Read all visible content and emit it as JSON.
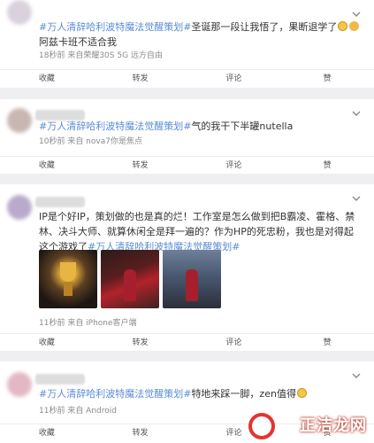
{
  "posts": [
    {
      "tag": "#万人清辞哈利波特魔法觉醒策划#",
      "text_parts": [
        "圣诞那一段让我悟了，果断退学了",
        "",
        "阿兹卡班不适合我"
      ],
      "meta": "18秒前 来自荣耀30S 5G 远方自由",
      "actions": [
        "收藏",
        "转发",
        "评论",
        "赞"
      ]
    },
    {
      "tag": "#万人清辞哈利波特魔法觉醒策划#",
      "text": "气的我干下半罐nutella",
      "meta": "10秒前 来自 nova7你是焦点",
      "actions": [
        "收藏",
        "转发",
        "评论",
        "赞"
      ]
    },
    {
      "text": "IP是个好IP，策划做的也是真的烂！工作室是怎么做到把B霸凌、霍格、禁林、决斗大师、就算休闲全是拜一遍的？作为HP的死忠粉，我也是对得起这个游戏了",
      "tag": "#万人清辞哈利波特魔法觉醒策划#",
      "meta": "11秒前 来自 iPhone客户端",
      "actions": [
        "收藏",
        "转发",
        "评论",
        "赞"
      ]
    },
    {
      "tag": "#万人清辞哈利波特魔法觉醒策划#",
      "text": "特地来踩一脚，zen值得",
      "meta": "11秒前 来自 Android",
      "actions": [
        "收藏",
        "转发",
        "评论",
        "赞"
      ]
    }
  ],
  "icons": {
    "emoji_1": "nerd-face-icon",
    "emoji_2": "crying-face-icon",
    "emoji_3": "sweat-face-icon"
  },
  "watermark": "正洁龙网",
  "colors": {
    "tag": "#5a8bd6",
    "background": "#efeff1"
  }
}
